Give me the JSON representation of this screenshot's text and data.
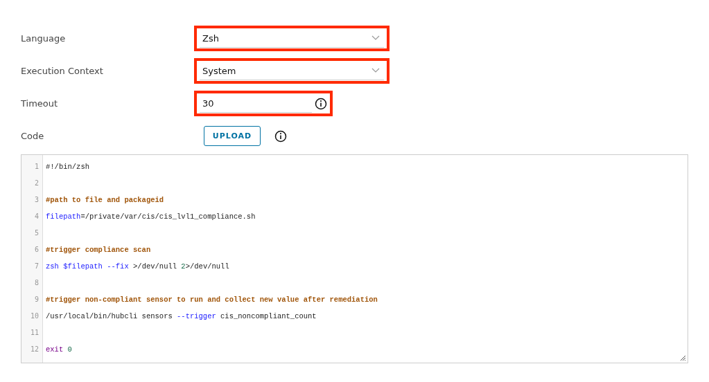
{
  "fields": [
    {
      "label": "Language",
      "kind": "select",
      "value": "Zsh",
      "highlighted": true
    },
    {
      "label": "Execution Context",
      "kind": "select",
      "value": "System",
      "highlighted": true
    },
    {
      "label": "Timeout",
      "kind": "input",
      "value": "30",
      "highlighted": true
    },
    {
      "label": "Code",
      "kind": "upload",
      "button": "UPLOAD",
      "highlighted": false
    }
  ],
  "code": {
    "lines": [
      {
        "number": "1",
        "tokens": [
          {
            "text": "#!/bin/zsh",
            "kind": "plain"
          }
        ]
      },
      {
        "number": "2"
      },
      {
        "number": "3",
        "tokens": [
          {
            "text": "#path to file and packageid",
            "kind": "comment"
          }
        ]
      },
      {
        "number": "4",
        "tokens": [
          {
            "text": "filepath",
            "kind": "variable"
          },
          {
            "text": "=/private/var/cis/cis_lvl1_compliance.sh",
            "kind": "plain"
          }
        ]
      },
      {
        "number": "5"
      },
      {
        "number": "6",
        "tokens": [
          {
            "text": "#trigger compliance scan",
            "kind": "comment"
          }
        ]
      },
      {
        "number": "7",
        "tokens": [
          {
            "text": "zsh $filepath --fix",
            "kind": "variable"
          },
          {
            "text": " >/dev/null ",
            "kind": "plain"
          },
          {
            "text": "2",
            "kind": "number"
          },
          {
            "text": ">/dev/null",
            "kind": "plain"
          }
        ]
      },
      {
        "number": "8"
      },
      {
        "number": "9",
        "tokens": [
          {
            "text": "#trigger non-compliant sensor to run and collect new value after remediation",
            "kind": "comment"
          }
        ]
      },
      {
        "number": "10",
        "tokens": [
          {
            "text": "/usr/local/bin/hubcli sensors ",
            "kind": "plain"
          },
          {
            "text": "--trigger",
            "kind": "variable"
          },
          {
            "text": " cis_noncompliant_count",
            "kind": "plain"
          }
        ]
      },
      {
        "number": "11"
      },
      {
        "number": "12",
        "tokens": [
          {
            "text": "exit ",
            "kind": "keyword"
          },
          {
            "text": "0",
            "kind": "number"
          }
        ]
      }
    ]
  }
}
